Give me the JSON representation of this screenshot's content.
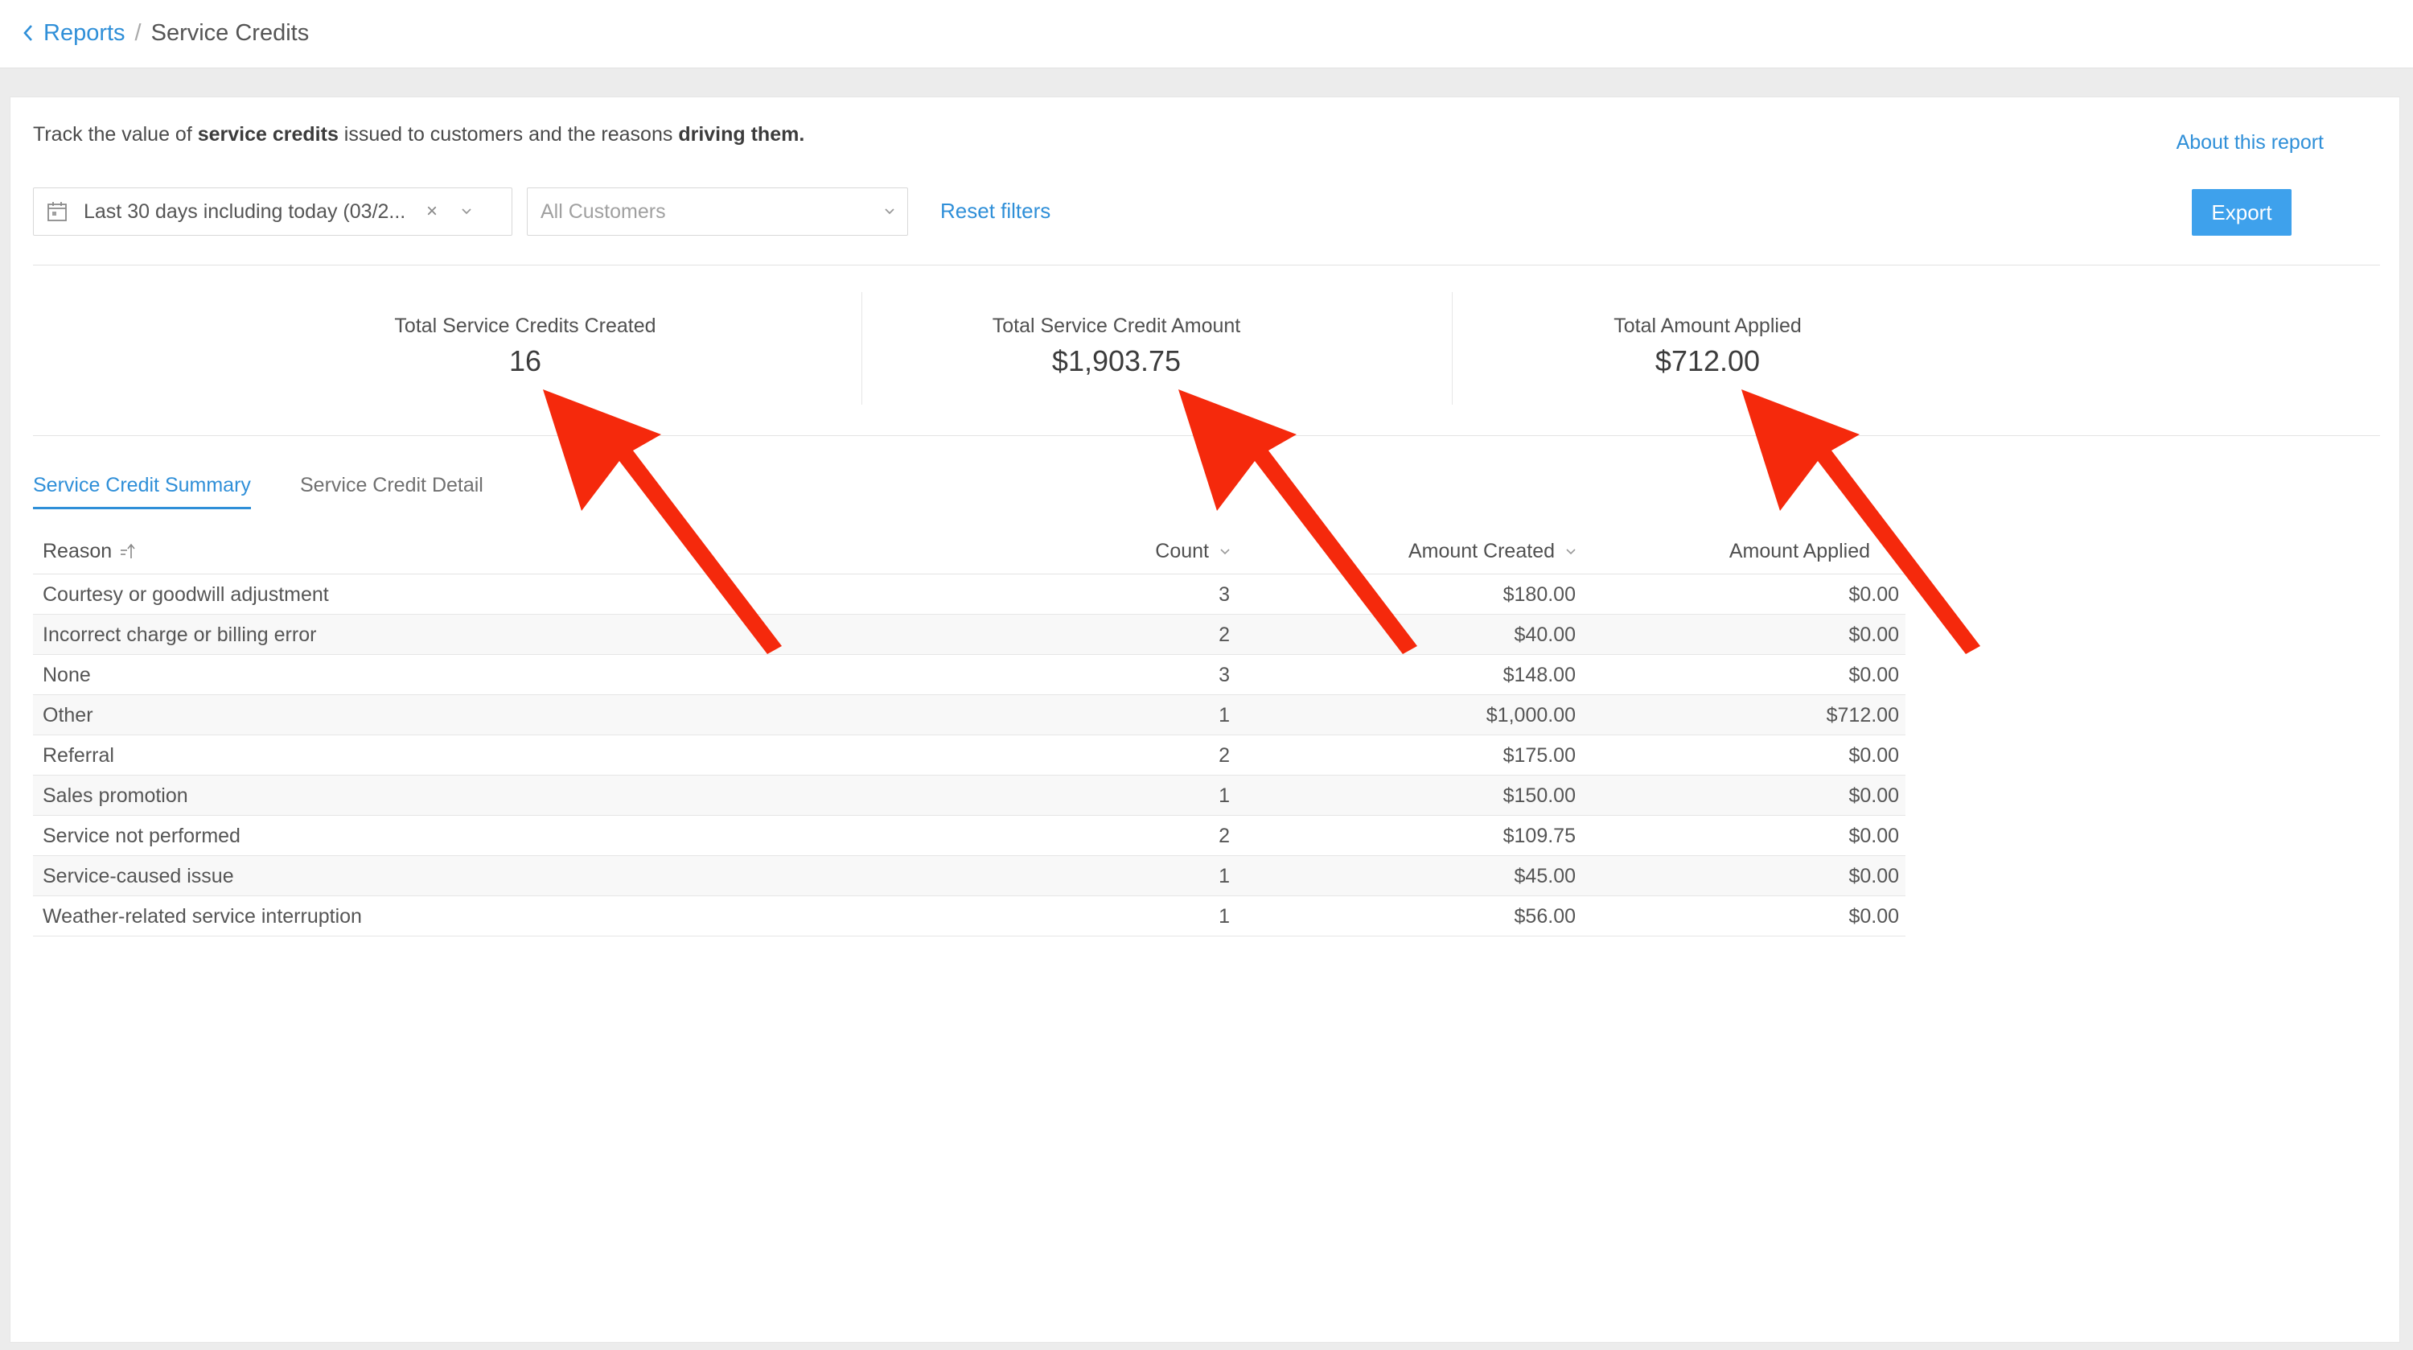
{
  "breadcrumb": {
    "back_label": "Reports",
    "separator": "/",
    "current": "Service Credits"
  },
  "report": {
    "description_prefix": "Track the value of ",
    "description_bold": "service credits",
    "description_middle": " issued to customers and the reasons ",
    "description_bold2": "driving them.",
    "about_link": "About this report"
  },
  "filters": {
    "date_value": "Last 30 days including today (03/2...",
    "clear_symbol": "×",
    "customer_placeholder": "All Customers",
    "reset_label": "Reset filters",
    "export_label": "Export"
  },
  "stats": [
    {
      "label": "Total Service Credits Created",
      "value": "16"
    },
    {
      "label": "Total Service Credit Amount",
      "value": "$1,903.75"
    },
    {
      "label": "Total Amount Applied",
      "value": "$712.00"
    }
  ],
  "tabs": [
    {
      "label": "Service Credit Summary",
      "active": true
    },
    {
      "label": "Service Credit Detail",
      "active": false
    }
  ],
  "table": {
    "headers": {
      "reason": "Reason",
      "count": "Count",
      "created": "Amount Created",
      "applied": "Amount Applied"
    },
    "rows": [
      {
        "reason": "Courtesy or goodwill adjustment",
        "count": "3",
        "created": "$180.00",
        "applied": "$0.00"
      },
      {
        "reason": "Incorrect charge or billing error",
        "count": "2",
        "created": "$40.00",
        "applied": "$0.00"
      },
      {
        "reason": "None",
        "count": "3",
        "created": "$148.00",
        "applied": "$0.00"
      },
      {
        "reason": "Other",
        "count": "1",
        "created": "$1,000.00",
        "applied": "$712.00"
      },
      {
        "reason": "Referral",
        "count": "2",
        "created": "$175.00",
        "applied": "$0.00"
      },
      {
        "reason": "Sales promotion",
        "count": "1",
        "created": "$150.00",
        "applied": "$0.00"
      },
      {
        "reason": "Service not performed",
        "count": "2",
        "created": "$109.75",
        "applied": "$0.00"
      },
      {
        "reason": "Service-caused issue",
        "count": "1",
        "created": "$45.00",
        "applied": "$0.00"
      },
      {
        "reason": "Weather-related service interruption",
        "count": "1",
        "created": "$56.00",
        "applied": "$0.00"
      }
    ]
  },
  "colors": {
    "accent": "#2f8fd8",
    "export_bg": "#3ea1ec",
    "annotation_arrow": "#f5290c"
  },
  "icons": [
    "chevron-left-icon",
    "calendar-icon",
    "clear-icon",
    "chevron-down-icon",
    "sort-icon"
  ]
}
